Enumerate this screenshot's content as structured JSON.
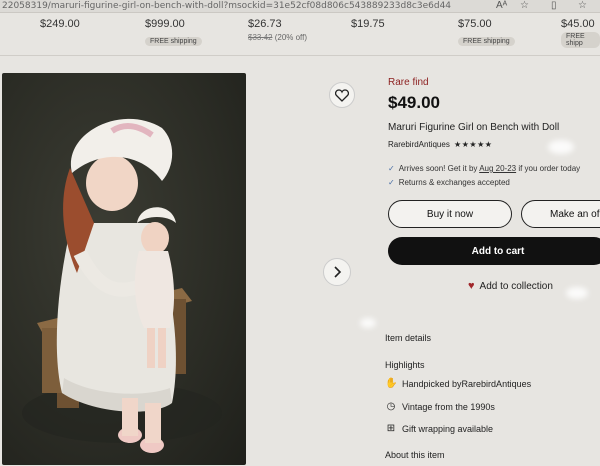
{
  "browser": {
    "url": "22058319/maruri-figurine-girl-on-bench-with-doll?msockid=31e52cf08d806c543889233d8c3e6d44"
  },
  "top_strip": [
    {
      "price": "$249.00",
      "sub": ""
    },
    {
      "price": "$999.00",
      "sub": "FREE shipping"
    },
    {
      "price": "$26.73",
      "old_price": "$33.42",
      "discount": "(20% off)"
    },
    {
      "price": "$19.75",
      "sub": ""
    },
    {
      "price": "$75.00",
      "sub": "FREE shipping"
    },
    {
      "price": "$45.00",
      "sub": "FREE shipp"
    }
  ],
  "product": {
    "badge": "Rare find",
    "price": "$49.00",
    "title": "Maruri Figurine Girl on Bench with Doll",
    "shop_name": "RarebirdAntiques",
    "stars": "★★★★★",
    "delivery_prefix": "Arrives soon! Get it by ",
    "delivery_date": "Aug 20-23",
    "delivery_suffix": " if you order today",
    "returns": "Returns & exchanges accepted"
  },
  "actions": {
    "buy_now": "Buy it now",
    "make_offer": "Make an of",
    "add_to_cart": "Add to cart",
    "add_to_collection": "Add to collection"
  },
  "details": {
    "item_details": "Item details",
    "highlights": "Highlights",
    "handpicked_prefix": "Handpicked by ",
    "handpicked_shop": "RarebirdAntiques",
    "vintage": "Vintage from the 1990s",
    "gift": "Gift wrapping available",
    "about": "About this item"
  },
  "colors": {
    "rare_find": "#8c1f1f",
    "cart_button": "#111111",
    "heart": "#a0262a"
  },
  "icons": [
    "heart-outline-icon",
    "chevron-right-icon",
    "check-icon",
    "heart-filled-icon",
    "hand-icon",
    "clock-icon",
    "gift-icon",
    "reader-mode-icon",
    "star-icon",
    "split-view-icon",
    "favorites-icon"
  ]
}
